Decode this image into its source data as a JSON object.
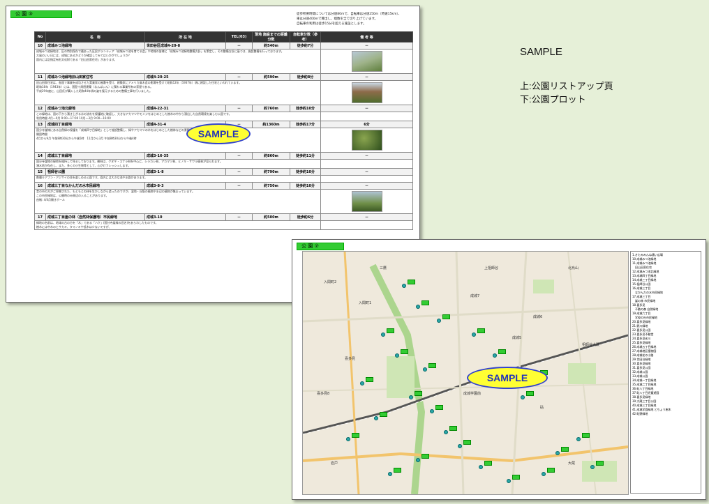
{
  "page1": {
    "title_tag": "公 園 ③",
    "note": [
      "徒歩所要時間については分速80mで、自転車は分速250m（時速15km）、",
      "車は分速400mで算出し、端数を全て切り上げています。",
      "自転車の利用は徒歩15分を超える施設とします。"
    ],
    "headers": [
      "No",
      "名　称",
      "所 在 地",
      "TEL(03)",
      "現地 施設までの距離分数",
      "自転車分数（参考）",
      "備 考 等"
    ],
    "rows": [
      {
        "no": "10",
        "name": "成城みつ池緑地",
        "addr": "世田谷区成城4-20-8",
        "tel": "－",
        "dist": "約540m",
        "walk": "徒歩約7分",
        "bike": "－",
        "desc": "成城みつ池緑地は、区の特別保存で最あった区民ボランティア「成城みつ池を育てる会」や地域の皆様と「成城みつ池緑地整備方針」を策定し、その整備方針に基づき、施設整備を行っております。",
        "desc2": "大風のいい日には、成城にあるかどうか確認してみてはいかがでしょうか？",
        "desc3": "園内には区指定有形文化財である「旧山田家住宅」があります。",
        "photo": "ph1"
      },
      {
        "no": "11",
        "name": "成城みつ池緑地旧山田家住宅",
        "addr": "成城4-20-25",
        "tel": "－",
        "dist": "約590m",
        "walk": "徒歩約8分",
        "bike": "－",
        "desc": "旧山田家住宅は、各国で事業を成功させた実業家の屋敷を受け、建築家にアメリカ風木造の影響を受けて昭和12年（1937年）頃に建設した住宅といわれています。",
        "desc2": "昭和18年（1943年）には、国登で周囲建築（なんばいん）に関わる事業所有の家屋である。",
        "desc3": "平成29年度に、山田氏が購入した昭和44年頃の姿を復元するための整備工事を行いました。",
        "photo": "ph2"
      },
      {
        "no": "12",
        "name": "成城みつ池北緑地",
        "addr": "成城4-22-31",
        "tel": "－",
        "dist": "約760m",
        "walk": "徒歩約10分",
        "bike": "－",
        "desc": "この緑地は、園の下から湧き上がる水の流れを保護地に確認し、大きなアカマツやモミジをはじめとした樹木の中から湧出した自然環境を楽しむ公園です。",
        "desc2": "利用時間 4月～9月 9:00～17:00 10月～3月 9:00～16:00",
        "desc3": "",
        "photo": ""
      },
      {
        "no": "13",
        "name": "成城四丁目緑地",
        "addr": "成城4-31-4",
        "tel": "－",
        "dist": "約1360m",
        "walk": "徒歩約17分",
        "bike": "6分",
        "desc": "国分寺崖線にある自然緑の保護を「成城四丁目緑地」として施設整備し、緑やアカマツの木をはじめとした樹林などの景観などが残っています。",
        "desc2": "開園時間",
        "desc3": "4月から9月 午前8時30分から午後5時　11月から3月 午前8時30分から午後4時",
        "photo": "ph3"
      },
      {
        "no": "14",
        "name": "成城三丁目緑地",
        "addr": "成城3-16-35",
        "tel": "－",
        "dist": "約860m",
        "walk": "徒歩約11分",
        "bike": "－",
        "desc": "国分寺崖線の緑地を維持して残るしております。樹林は、クヌギ・コナラ林を中心に、シラカシ林、アカマツ林、ヒノキ・サワラ植林が見られます。",
        "desc2": "湧水地が存在し、また、多くの小生物等として、心がけフレッシュします。",
        "desc3": "",
        "photo": ""
      },
      {
        "no": "15",
        "name": "祖師谷公園",
        "addr": "成城3-1-8",
        "tel": "－",
        "dist": "約790m",
        "walk": "徒歩約10分",
        "bike": "－",
        "desc": "数種キアブン・アジサイの花を楽しめる公園です。園内には大きな池や水路があります。",
        "desc2": "",
        "desc3": "",
        "photo": ""
      },
      {
        "no": "16",
        "name": "成城三丁目なかんだの水市民緑地",
        "addr": "成城3-8-3",
        "tel": "－",
        "dist": "約750m",
        "walk": "徒歩約10分",
        "bike": "－",
        "desc": "昔の市の方がご寄贈された、もともとの林を生かしながら造ったのですが、湿地・谷筋の植物や水辺の植物が集まっています。",
        "desc2": "この市民緑地は、公開時のみ周辺の入ることがあります。",
        "desc3": "",
        "photo": "ph4",
        "extra": "由緒: 4/4月開きポール"
      },
      {
        "no": "17",
        "name": "成城三丁目崖の林（自然林保護地）市民緑地",
        "addr": "成城3-10",
        "tel": "－",
        "dist": "約500m",
        "walk": "徒歩約6分",
        "bike": "－",
        "desc": "緑地の名前は、地域の古の方を「木」である「ハケ」(国分寺崖線の旧名)をあらわしたものです。",
        "desc2": "樹木には中木のヒサカキ、タマノキや低木は少ないですが、",
        "desc3": "",
        "photo": ""
      }
    ]
  },
  "page2": {
    "title_tag": "公 園 ⑦",
    "legend": [
      "1.きたみみんね通い広場",
      "10.成城みつ池緑地",
      "11.成城みつ池緑地",
      "　旧山田家住宅",
      "12.成城みつ池北緑地",
      "13.成城四丁目緑地",
      "14.成城三丁目緑地",
      "15.祖師谷公園",
      "16.成城三丁目",
      "　なかんだの水市民緑地",
      "17.成城三丁目",
      "　崖の林 市民緑地",
      "18.喜多見",
      "　不動の森 自然緑地",
      "19.成城六丁目",
      "　学校の社市民緑地",
      "20.喜多見緑地",
      "21.野川緑地",
      "22.喜多見公園",
      "23.喜多見不動堂",
      "24.喜多見氷川",
      "25.喜多見緑地",
      "26.成城五丁目緑地",
      "27.成城地区植物園",
      "28.成城花の小路",
      "29.世田谷緑地",
      "30.喜多見緑地",
      "31.喜多見公園",
      "32.成城公園",
      "33.成城公園",
      "34.成城一丁目緑地",
      "35.成城二丁目緑地",
      "36.砧八丁目緑地",
      "37.砧八丁目児童遊園",
      "38.喜多見緑地",
      "39.大蔵三丁目公園",
      "40.成城三丁目緑地",
      "41.成城学園緑地 とちょう樹木",
      "42.砧野緑地"
    ],
    "labels": [
      "入間町2",
      "入間町1",
      "成城7",
      "成城6",
      "成城5",
      "喜多見",
      "砧",
      "大蔵",
      "成城学園前",
      "祖師谷大蔵",
      "岩戸",
      "喜多見8",
      "三鷹",
      "上祖師谷",
      "北烏山"
    ]
  },
  "sample_label": "SAMPLE",
  "caption": {
    "title": "SAMPLE",
    "line1": "上:公園リストアップ頁",
    "line2": "下:公園プロット"
  }
}
